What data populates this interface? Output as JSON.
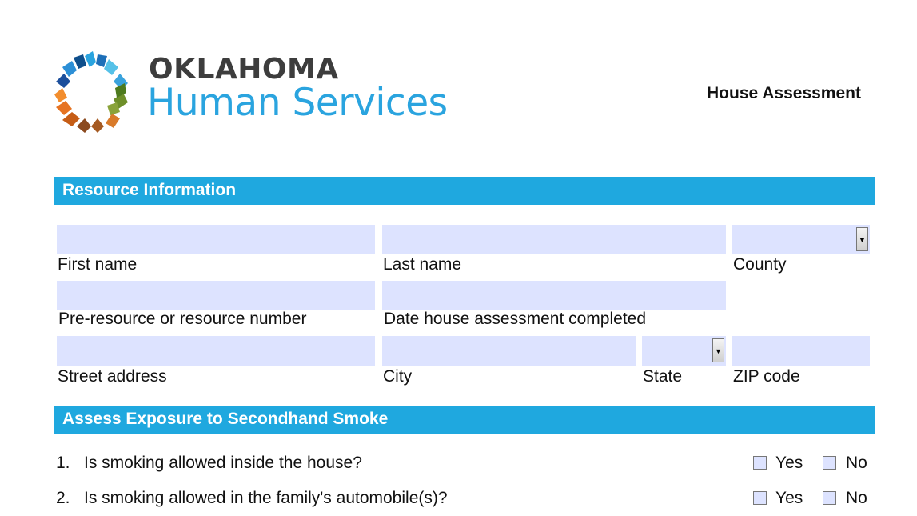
{
  "header": {
    "org_name": "OKLAHOMA",
    "brand_name": "Human Services",
    "document_title": "House Assessment",
    "colors": {
      "brand_blue": "#2aa4df",
      "section_blue": "#1fa8df",
      "field_fill": "#dde3ff"
    }
  },
  "sections": {
    "resource": {
      "title": "Resource Information"
    },
    "smoke": {
      "title": "Assess Exposure to Secondhand Smoke"
    }
  },
  "fields": {
    "first_name": {
      "label": "First name",
      "value": ""
    },
    "last_name": {
      "label": "Last name",
      "value": ""
    },
    "county": {
      "label": "County",
      "value": "",
      "icon": "dropdown-arrow-icon"
    },
    "resource_number": {
      "label": "Pre-resource or resource number",
      "value": ""
    },
    "date_completed": {
      "label": "Date house assessment completed",
      "value": ""
    },
    "street": {
      "label": "Street address",
      "value": ""
    },
    "city": {
      "label": "City",
      "value": ""
    },
    "state": {
      "label": "State",
      "value": "",
      "icon": "dropdown-arrow-icon"
    },
    "zip": {
      "label": "ZIP code",
      "value": ""
    }
  },
  "questions": [
    {
      "number": "1.",
      "text": "Is smoking allowed inside the house?",
      "yes": "Yes",
      "no": "No"
    },
    {
      "number": "2.",
      "text": "Is smoking allowed in the family's automobile(s)?",
      "yes": "Yes",
      "no": "No"
    }
  ]
}
